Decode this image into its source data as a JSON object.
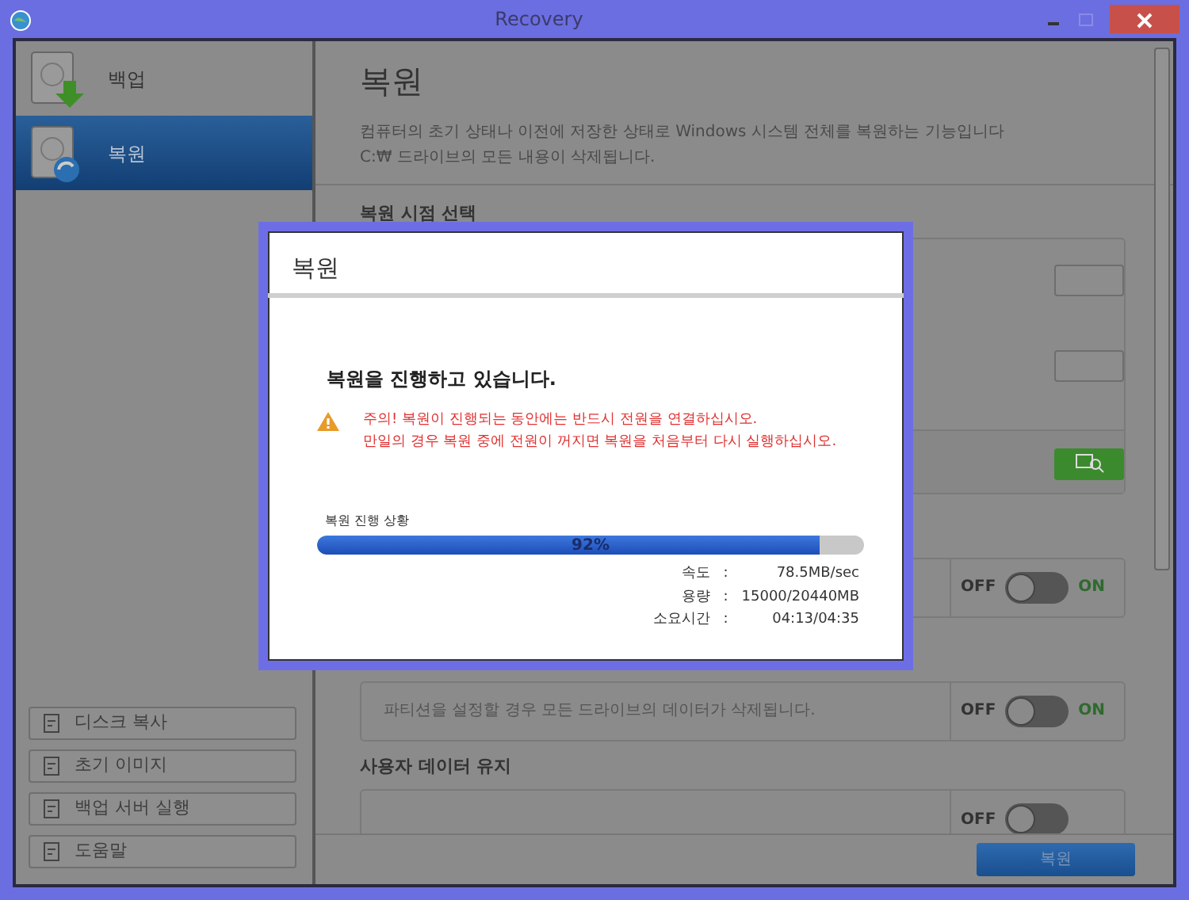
{
  "window": {
    "title": "Recovery"
  },
  "sidebar": {
    "items": [
      {
        "label": "백업",
        "selected": false
      },
      {
        "label": "복원",
        "selected": true
      }
    ],
    "tools": [
      "디스크 복사",
      "초기 이미지",
      "백업 서버 실행",
      "도움말"
    ]
  },
  "main": {
    "title": "복원",
    "description": [
      "컴퓨터의 초기 상태나 이전에 저장한 상태로 Windows 시스템 전체를 복원하는 기능입니다",
      "C:₩ 드라이브의 모든 내용이 삭제됩니다."
    ],
    "section": "복원 시점 선택",
    "options": [
      {
        "on": false,
        "off_label": "OFF",
        "on_label": "ON"
      },
      {
        "text": "파티션을 설정할 경우 모든 드라이브의 데이터가 삭제됩니다.",
        "on": false,
        "off_label": "OFF",
        "on_label": "ON"
      },
      {
        "heading": "사용자 데이터 유지",
        "on": false,
        "off_label": "OFF"
      }
    ],
    "button": "복원"
  },
  "dialog": {
    "title": "복원",
    "message": "복원을 진행하고 있습니다.",
    "warning": [
      "주의! 복원이 진행되는 동안에는 반드시 전원을 연결하십시오.",
      "만일의 경우 복원 중에 전원이 꺼지면 복원을 처음부터 다시 실행하십시오."
    ],
    "progress_label": "복원 진행 상황",
    "level": 0.92,
    "percent": "92%",
    "stats": [
      {
        "label": "속도",
        "sep": ":",
        "value": "78.5MB/sec"
      },
      {
        "label": "용량",
        "sep": ":",
        "value": "15000/20440MB"
      },
      {
        "label": "소요시간",
        "sep": ":",
        "value": "04:13/04:35"
      }
    ]
  }
}
